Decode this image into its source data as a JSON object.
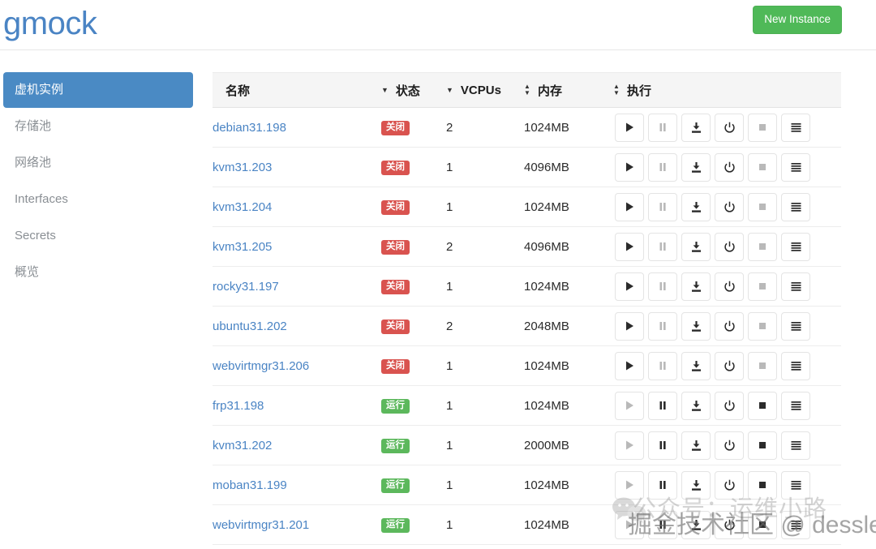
{
  "header": {
    "brand": "gmock",
    "new_instance_label": "New Instance",
    "accent_green": "#4fb958",
    "brand_color": "#4a84c4"
  },
  "sidebar": {
    "items": [
      {
        "label": "虚机实例",
        "active": true
      },
      {
        "label": "存储池",
        "active": false
      },
      {
        "label": "网络池",
        "active": false
      },
      {
        "label": "Interfaces",
        "active": false
      },
      {
        "label": "Secrets",
        "active": false
      },
      {
        "label": "概览",
        "active": false
      }
    ]
  },
  "table": {
    "columns": [
      {
        "label": "名称",
        "sort": "caret"
      },
      {
        "label": "状态",
        "sort": "caret"
      },
      {
        "label": "VCPUs",
        "sort": "updown"
      },
      {
        "label": "内存",
        "sort": "updown"
      },
      {
        "label": "执行",
        "sort": "none"
      }
    ],
    "status_labels": {
      "stopped": "关闭",
      "running": "运行"
    },
    "status_colors": {
      "stopped": "#d9534f",
      "running": "#5cb85c"
    },
    "action_icons": [
      "play-icon",
      "pause-icon",
      "snapshot-icon",
      "power-icon",
      "stop-icon",
      "menu-icon"
    ],
    "rows": [
      {
        "name": "debian31.198",
        "status": "stopped",
        "status_label": "关闭",
        "vcpus": "2",
        "memory": "1024MB"
      },
      {
        "name": "kvm31.203",
        "status": "stopped",
        "status_label": "关闭",
        "vcpus": "1",
        "memory": "4096MB"
      },
      {
        "name": "kvm31.204",
        "status": "stopped",
        "status_label": "关闭",
        "vcpus": "1",
        "memory": "1024MB"
      },
      {
        "name": "kvm31.205",
        "status": "stopped",
        "status_label": "关闭",
        "vcpus": "2",
        "memory": "4096MB"
      },
      {
        "name": "rocky31.197",
        "status": "stopped",
        "status_label": "关闭",
        "vcpus": "1",
        "memory": "1024MB"
      },
      {
        "name": "ubuntu31.202",
        "status": "stopped",
        "status_label": "关闭",
        "vcpus": "2",
        "memory": "2048MB"
      },
      {
        "name": "webvirtmgr31.206",
        "status": "stopped",
        "status_label": "关闭",
        "vcpus": "1",
        "memory": "1024MB"
      },
      {
        "name": "frp31.198",
        "status": "running",
        "status_label": "运行",
        "vcpus": "1",
        "memory": "1024MB"
      },
      {
        "name": "kvm31.202",
        "status": "running",
        "status_label": "运行",
        "vcpus": "1",
        "memory": "2000MB"
      },
      {
        "name": "moban31.199",
        "status": "running",
        "status_label": "运行",
        "vcpus": "1",
        "memory": "1024MB"
      },
      {
        "name": "webvirtmgr31.201",
        "status": "running",
        "status_label": "运行",
        "vcpus": "1",
        "memory": "1024MB"
      }
    ]
  },
  "watermarks": {
    "top": "公众号：运维小路",
    "bottom": "掘金技术社区 @ dessler"
  }
}
